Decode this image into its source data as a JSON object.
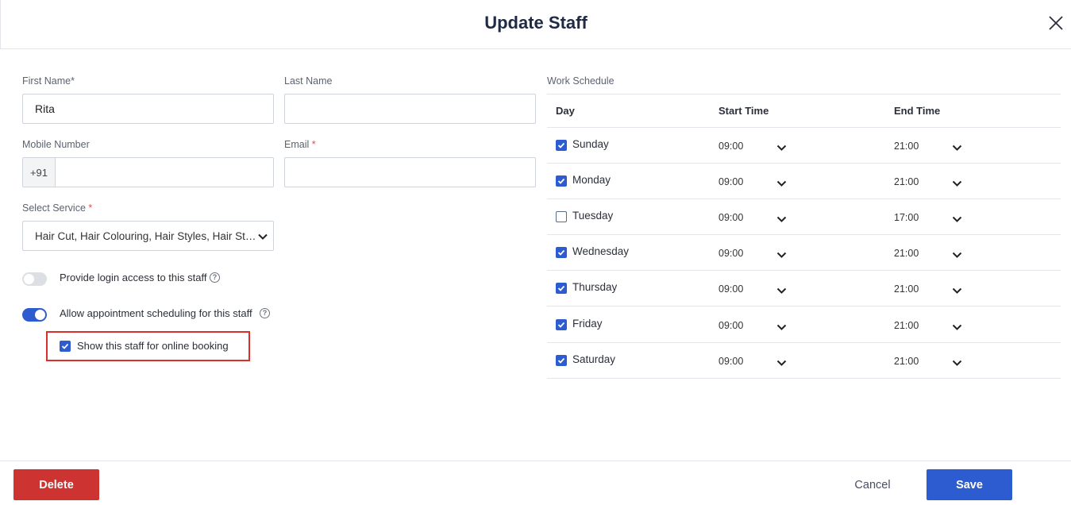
{
  "dialog": {
    "title": "Update Staff"
  },
  "form": {
    "first_name_label": "First Name*",
    "first_name_value": "Rita",
    "last_name_label": "Last Name",
    "last_name_value": "",
    "mobile_label": "Mobile Number",
    "mobile_prefix": "+91",
    "mobile_value": "",
    "email_label": "Email",
    "email_required": "*",
    "email_value": "",
    "service_label": "Select Service",
    "service_required": "*",
    "service_value": "Hair Cut, Hair Colouring, Hair Styles, Hair Straightening",
    "login_toggle_label": "Provide login access to this staff",
    "login_toggle_on": false,
    "appointment_toggle_label": "Allow appointment scheduling for this staff",
    "appointment_toggle_on": true,
    "online_booking_label": "Show this staff for online booking",
    "online_booking_checked": true
  },
  "schedule": {
    "label": "Work Schedule",
    "headers": {
      "day": "Day",
      "start": "Start Time",
      "end": "End Time"
    },
    "rows": [
      {
        "day": "Sunday",
        "checked": true,
        "start": "09:00",
        "end": "21:00"
      },
      {
        "day": "Monday",
        "checked": true,
        "start": "09:00",
        "end": "21:00"
      },
      {
        "day": "Tuesday",
        "checked": false,
        "start": "09:00",
        "end": "17:00"
      },
      {
        "day": "Wednesday",
        "checked": true,
        "start": "09:00",
        "end": "21:00"
      },
      {
        "day": "Thursday",
        "checked": true,
        "start": "09:00",
        "end": "21:00"
      },
      {
        "day": "Friday",
        "checked": true,
        "start": "09:00",
        "end": "21:00"
      },
      {
        "day": "Saturday",
        "checked": true,
        "start": "09:00",
        "end": "21:00"
      }
    ]
  },
  "footer": {
    "delete_label": "Delete",
    "cancel_label": "Cancel",
    "save_label": "Save"
  },
  "colors": {
    "primary": "#2d5bd0",
    "danger": "#cd3330",
    "highlight": "#d9302a"
  }
}
